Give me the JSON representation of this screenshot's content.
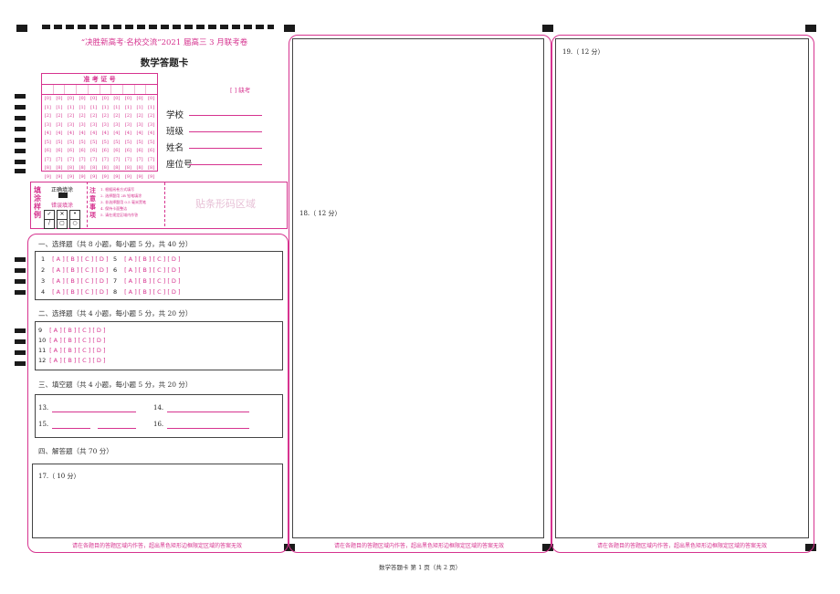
{
  "header": {
    "exam_title": "“决胜新高考·名校交流”2021 届高三 3 月联考卷",
    "card_title": "数学答题卡"
  },
  "admission": {
    "label": "准 考 证 号",
    "digits": [
      "0",
      "1",
      "2",
      "3",
      "4",
      "5",
      "6",
      "7",
      "8",
      "9"
    ],
    "missing_label": "[ ]  缺考"
  },
  "info": {
    "school": "学校",
    "class": "班级",
    "name": "姓名",
    "seat": "座位号"
  },
  "fill_example": {
    "title": "填涂样例",
    "correct": "正确填涂",
    "wrong": "错误填涂",
    "notice_title": "注意事项",
    "notices": [
      "1. 根据阅卷方式填写",
      "2. 选择题用 2B 铅笔填涂",
      "3. 非选择题用 0.5 毫米黑笔",
      "4. 保持卡面整洁",
      "5. 请在规定区域内作答"
    ],
    "barcode": "贴条形码区域"
  },
  "sections": {
    "s1": "一、选择题（共 8 小题，每小题 5 分，共 40 分）",
    "s2": "二、选择题（共 4 小题，每小题 5 分，共 20 分）",
    "s3": "三、填空题（共 4 小题，每小题 5 分，共 20 分）",
    "s4": "四、解答题（共 70 分）"
  },
  "choice_options": "[ A ] [ B ] [ C ] [ D ]",
  "q_mc1_left": [
    "1",
    "2",
    "3",
    "4"
  ],
  "q_mc1_right": [
    "5",
    "6",
    "7",
    "8"
  ],
  "q_mc2": [
    "9",
    "10",
    "11",
    "12"
  ],
  "fill_blank": {
    "q13": "13.",
    "q14": "14.",
    "q15": "15.",
    "q16": "16."
  },
  "answers": {
    "q17": "17.（ 10 分）",
    "q18": "18.（ 12 分）",
    "q19": "19.（ 12 分）"
  },
  "footer_note": "请在各题目的答题区域内作答，超出黑色矩形边框限定区域的答案无效",
  "page_footer": "数学答题卡    第 1 页（共 2 页）"
}
